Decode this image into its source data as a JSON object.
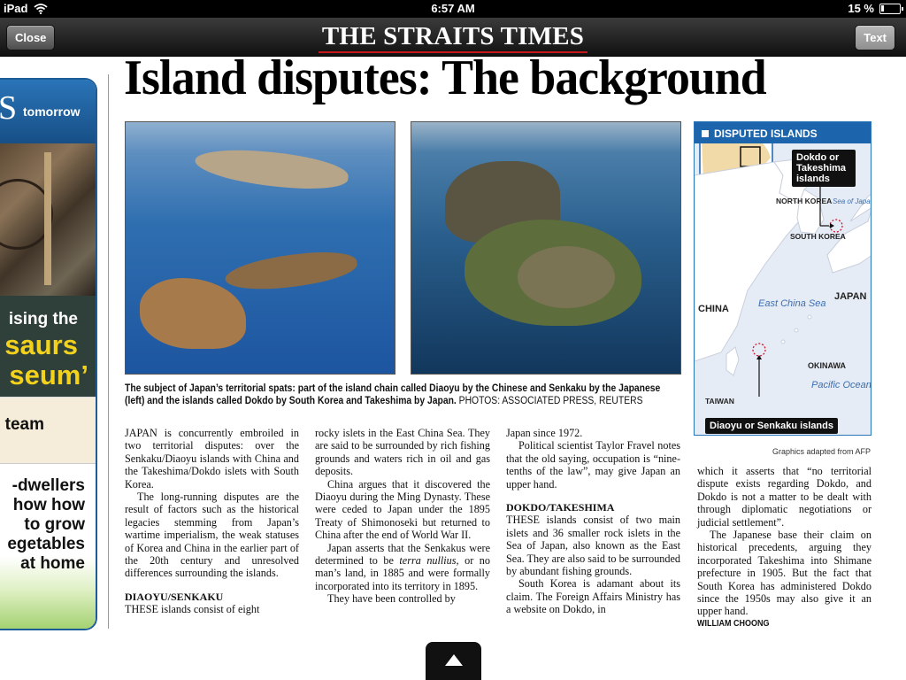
{
  "status_bar": {
    "device": "iPad",
    "time": "6:57 AM",
    "battery_pct": "15 %"
  },
  "nav": {
    "close_label": "Close",
    "masthead": "THE STRAITS TIMES",
    "text_label": "Text"
  },
  "ad": {
    "tomorrow_big": "S",
    "tomorrow_small": "tomorrow",
    "line1": "ising the",
    "line2": "saurs",
    "line3": "seum’",
    "team": "team",
    "grow_lines": [
      "-dwellers",
      "how how",
      "to grow",
      "egetables",
      "at home"
    ]
  },
  "article": {
    "headline": "Island disputes: The background",
    "caption_bold": "The subject of Japan’s territorial spats: part of the island chain called Diaoyu by the Chinese and Senkaku by the Japanese (left) and the islands called Dokdo by South Korea and Takeshima by Japan.",
    "caption_credit": "PHOTOS: ASSOCIATED PRESS, REUTERS",
    "col1": {
      "p1": "JAPAN is concurrently embroiled in two territorial disputes: over the Senkaku/Diaoyu islands with China and the Takeshima/Dokdo islets with South Korea.",
      "p2": "The long-running disputes are the result of factors such as the historical legacies stemming from Japan’s wartime imperialism, the weak statuses of Korea and China in the earlier part of the 20th century and unresolved differences surrounding the islands.",
      "sub": "DIAOYU/SENKAKU",
      "p3": "THESE islands consist of eight"
    },
    "col2": {
      "p1": "rocky islets in the East China Sea. They are said to be surrounded by rich fishing grounds and waters rich in oil and gas deposits.",
      "p2": "China argues that it discovered the Diaoyu during the Ming Dynasty. These were ceded to Japan under the 1895 Treaty of Shimonoseki but returned to China after the end of World War II.",
      "p3_a": "Japan asserts that the Senkakus were determined to be ",
      "p3_em": "terra nullius",
      "p3_b": ", or no man’s land, in 1885 and were formally incorporated into its territory in 1895.",
      "p4": "They have been controlled by"
    },
    "col3": {
      "p1": "Japan since 1972.",
      "p2": "Political scientist Taylor Fravel notes that the old saying, occupation is “nine-tenths of the law”, may give Japan an upper hand.",
      "sub": "DOKDO/TAKESHIMA",
      "p3": "THESE islands consist of two main islets and 36 smaller rock islets in the Sea of Japan, also known as the East Sea. They are also said to be surrounded by abundant fishing grounds.",
      "p4": "South Korea is adamant about its claim. The Foreign Affairs Ministry has a website on Dokdo, in"
    },
    "col4": {
      "p1": "which it asserts that “no territorial dispute exists regarding Dokdo, and Dokdo is not a matter to be dealt with through diplomatic negotiations or judicial settlement”.",
      "p2": "The Japanese base their claim on historical precedents, arguing they incorporated Takeshima into Shimane prefecture in 1905. But the fact that South Korea has administered Dokdo since the 1950s may also give it an upper hand.",
      "byline": "WILLIAM CHOONG"
    }
  },
  "map": {
    "title": "DISPUTED ISLANDS",
    "callout_dokdo": "Dokdo or Takeshima islands",
    "callout_diaoyu": "Diaoyu or Senkaku islands",
    "north_korea": "NORTH KOREA",
    "south_korea": "SOUTH KOREA",
    "sea_of_japan": "Sea of Japan/ East Sea",
    "china": "CHINA",
    "japan": "JAPAN",
    "east_china_sea": "East China Sea",
    "okinawa": "OKINAWA",
    "pacific": "Pacific Ocean",
    "taiwan": "TAIWAN",
    "credit": "Graphics adapted from AFP"
  },
  "colors": {
    "brand_blue": "#1c65ad",
    "masthead_red": "#c7161c"
  },
  "icons": {
    "wifi": "wifi-icon",
    "battery": "battery-icon",
    "next_page": "up-arrow-icon"
  }
}
